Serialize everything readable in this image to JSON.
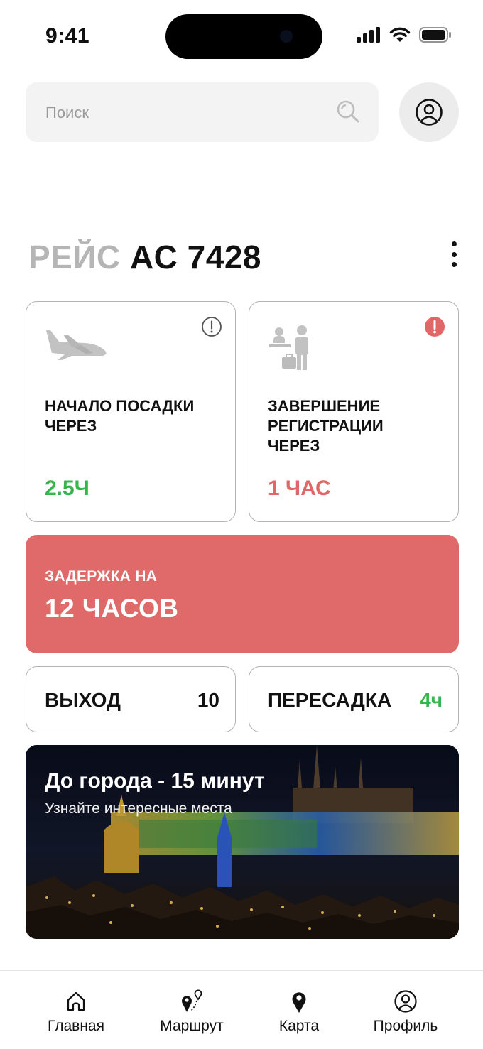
{
  "status_bar": {
    "time": "9:41"
  },
  "search": {
    "placeholder": "Поиск"
  },
  "flight": {
    "prefix": "РЕЙС",
    "number": "AC 7428"
  },
  "cards": {
    "boarding": {
      "label": "НАЧАЛО ПОСАДКИ ЧЕРЕЗ",
      "value": "2.5Ч"
    },
    "checkin": {
      "label": "ЗАВЕРШЕНИЕ РЕГИСТРАЦИИ ЧЕРЕЗ",
      "value": "1 ЧАС"
    }
  },
  "delay": {
    "label": "ЗАДЕРЖКА НА",
    "value": "12 ЧАСОВ"
  },
  "gate": {
    "label": "ВЫХОД",
    "value": "10"
  },
  "transfer": {
    "label": "ПЕРЕСАДКА",
    "value": "4ч"
  },
  "banner": {
    "title": "До города - 15 минут",
    "subtitle": "Узнайте интересные места"
  },
  "tabs": [
    {
      "label": "Главная",
      "icon": "home-icon"
    },
    {
      "label": "Маршрут",
      "icon": "route-icon"
    },
    {
      "label": "Карта",
      "icon": "map-pin-icon"
    },
    {
      "label": "Профиль",
      "icon": "profile-icon"
    }
  ],
  "colors": {
    "green": "#34b54d",
    "red": "#e06767",
    "delay_bg": "#e06a6a"
  }
}
